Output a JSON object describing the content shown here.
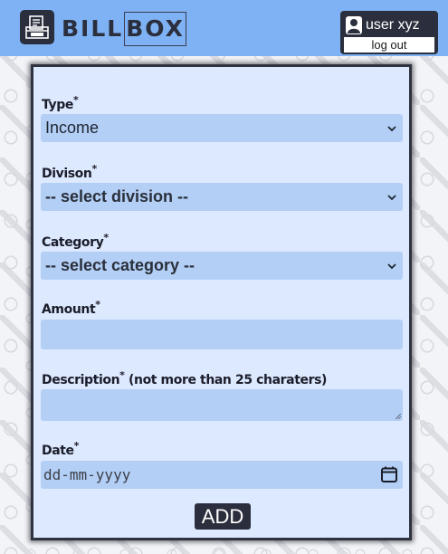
{
  "header": {
    "brand_bill": "BILL",
    "brand_box": "BOX",
    "logo_icon": "receipt-box-icon",
    "user_icon": "user-icon",
    "user_name": "user xyz",
    "logout_label": "log out"
  },
  "form": {
    "type": {
      "label": "Type",
      "required_mark": "*",
      "value": "Income"
    },
    "division": {
      "label": "Divison",
      "required_mark": "*",
      "value": "-- select division --"
    },
    "category": {
      "label": "Category",
      "required_mark": "*",
      "value": "-- select category --"
    },
    "amount": {
      "label": "Amount",
      "required_mark": "*",
      "value": ""
    },
    "description": {
      "label": "Description",
      "required_mark": "*",
      "hint": "(not more than 25 charaters)",
      "value": ""
    },
    "date": {
      "label": "Date",
      "required_mark": "*",
      "placeholder": "dd-mm-yyyy",
      "icon": "calendar-icon"
    },
    "submit_label": "ADD"
  },
  "colors": {
    "header_bg": "#7fb2f4",
    "dark": "#2b2f3d",
    "card_bg": "#dde9ff",
    "field_bg": "#b3cff6"
  }
}
